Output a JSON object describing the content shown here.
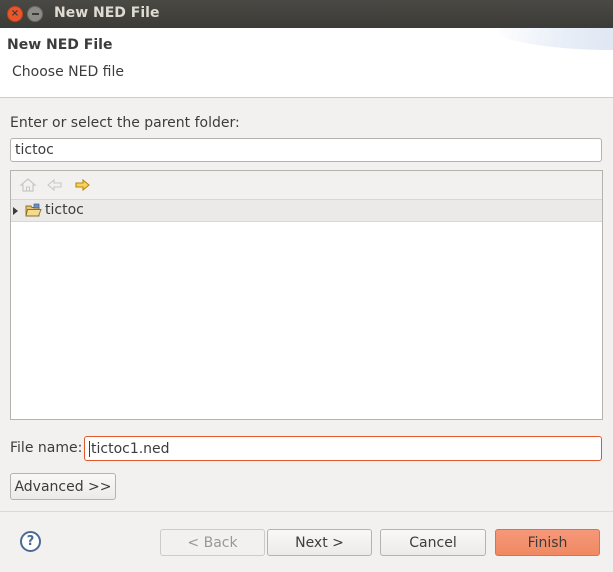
{
  "window": {
    "title": "New NED File"
  },
  "header": {
    "title": "New NED File",
    "description": "Choose NED file"
  },
  "folder": {
    "label": "Enter or select the parent folder:",
    "value": "tictoc"
  },
  "tree": {
    "toolbar_icons": [
      "home-icon",
      "back-arrow-icon",
      "forward-arrow-icon"
    ],
    "items": [
      {
        "label": "tictoc",
        "icon": "open-project-folder-icon",
        "expanded": false
      }
    ]
  },
  "file_name": {
    "label": "File name:",
    "value": "tictoc1.ned"
  },
  "buttons": {
    "advanced": "Advanced >>",
    "back": "< Back",
    "next": "Next >",
    "cancel": "Cancel",
    "finish": "Finish",
    "help": "?"
  },
  "colors": {
    "accent": "#f08962",
    "titlebar": "#3c3b37",
    "focus_border": "#e0592b"
  }
}
